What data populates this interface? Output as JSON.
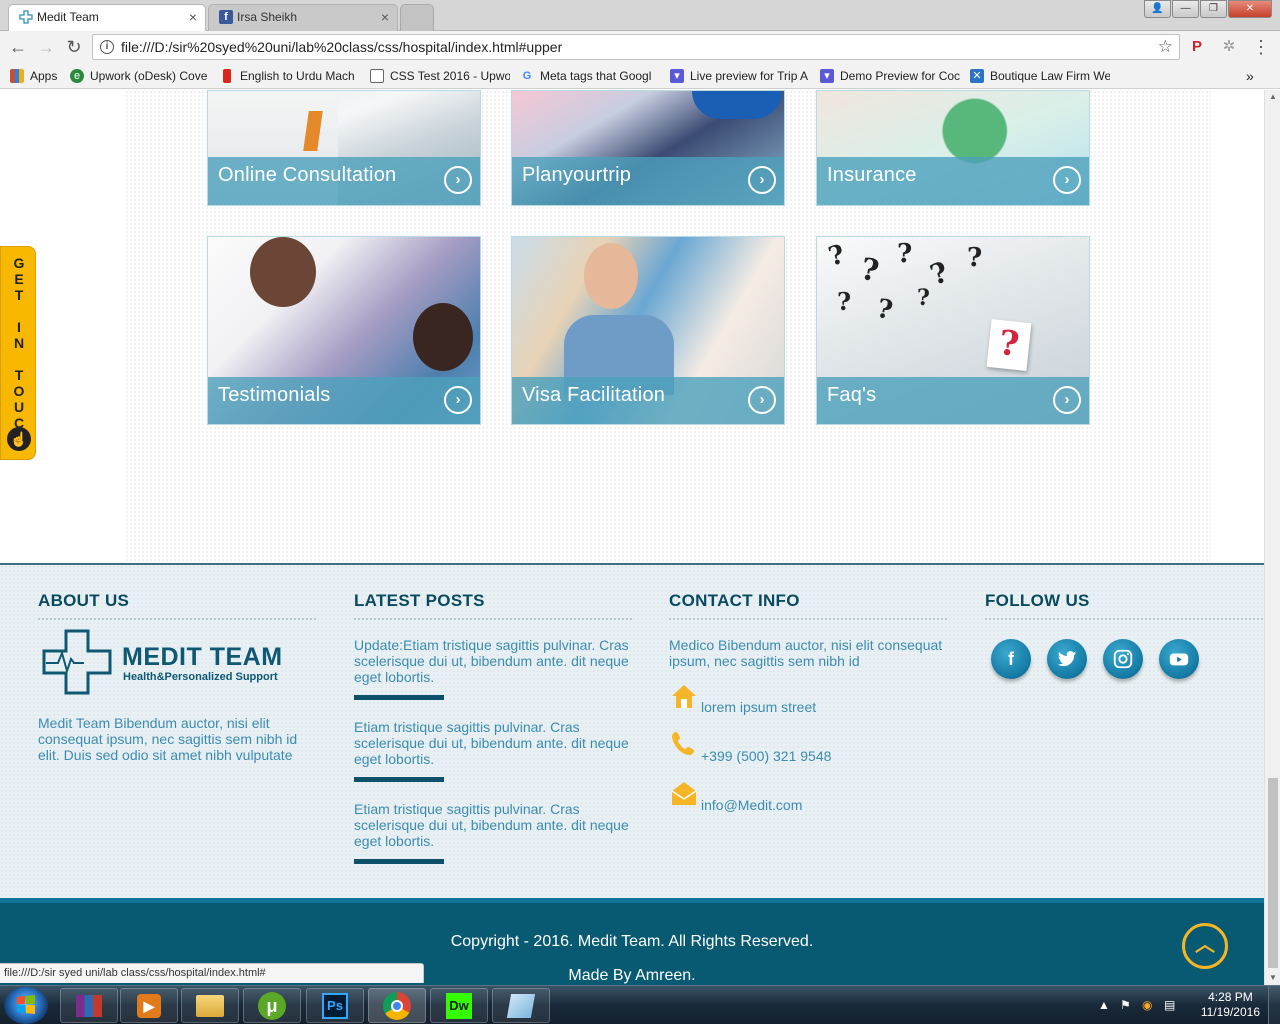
{
  "browser": {
    "tabs": [
      {
        "title": "Medit Team",
        "active": true
      },
      {
        "title": "Irsa Sheikh",
        "active": false
      }
    ],
    "address": "file:///D:/sir%20syed%20uni/lab%20class/css/hospital/index.html#upper",
    "bookmarks": [
      {
        "label": "Apps",
        "icon": "apps-grid-icon",
        "color": "#d04a2c"
      },
      {
        "label": "Upwork (oDesk) Cove",
        "icon": "upwork-icon",
        "color": "#2a8a3a"
      },
      {
        "label": "English to Urdu Mach",
        "icon": "translate-icon",
        "color": "#d9251c"
      },
      {
        "label": "CSS Test 2016 - Upwo",
        "icon": "page-icon",
        "color": "#666666"
      },
      {
        "label": "Meta tags that Googl",
        "icon": "google-icon",
        "color": "#4285f4"
      },
      {
        "label": "Live preview for Trip A",
        "icon": "themeforest-icon",
        "color": "#5a5ad6"
      },
      {
        "label": "Demo Preview for Coc",
        "icon": "themeforest-icon",
        "color": "#5a5ad6"
      },
      {
        "label": "Boutique Law Firm We",
        "icon": "x-logo-icon",
        "color": "#2b73c8"
      }
    ]
  },
  "services": [
    {
      "title": "Online Consultation",
      "arrow": "›"
    },
    {
      "title": "Planyourtrip",
      "arrow": "›"
    },
    {
      "title": "Insurance",
      "arrow": "›"
    },
    {
      "title": "Testimonials",
      "arrow": "›"
    },
    {
      "title": "Visa Facilitation",
      "arrow": "›"
    },
    {
      "title": "Faq's",
      "arrow": "›"
    }
  ],
  "get_in_touch": "G\nE\nT\n \nI\nN\n \nT\nO\nU\nC\nH",
  "footer": {
    "about": {
      "heading": "ABOUT US",
      "logo_name": "MEDIT TEAM",
      "logo_tagline": "Health&Personalized Support",
      "text": "Medit Team Bibendum auctor, nisi elit consequat ipsum, nec sagittis sem nibh id elit. Duis sed odio sit amet nibh vulputate"
    },
    "posts": {
      "heading": "LATEST POSTS",
      "items": [
        "Update:Etiam tristique sagittis pulvinar. Cras scelerisque dui ut, bibendum ante. dit neque eget lobortis.",
        "Etiam tristique sagittis pulvinar. Cras scelerisque dui ut, bibendum ante. dit neque eget lobortis.",
        "Etiam tristique sagittis pulvinar. Cras scelerisque dui ut, bibendum ante. dit neque eget lobortis."
      ]
    },
    "contact": {
      "heading": "CONTACT INFO",
      "intro": "Medico Bibendum auctor, nisi elit consequat ipsum, nec sagittis sem nibh id",
      "address": "lorem ipsum street",
      "phone": "+399 (500) 321 9548",
      "email": "info@Medit.com"
    },
    "follow": {
      "heading": "FOLLOW US",
      "networks": [
        "facebook",
        "twitter",
        "instagram",
        "youtube"
      ]
    },
    "copyright": "Copyright - 2016. Medit Team. All Rights Reserved.",
    "made_by": "Made By Amreen."
  },
  "status_url": "file:///D:/sir syed uni/lab class/css/hospital/index.html#",
  "taskbar": {
    "time": "4:28 PM",
    "date": "11/19/2016",
    "apps": [
      "winrar",
      "media-player",
      "file-explorer",
      "utorrent",
      "photoshop",
      "chrome",
      "dreamweaver",
      "notepad"
    ]
  },
  "colors": {
    "heading": "#0a4a60",
    "body_text": "#3c8cb0",
    "footer_bar": "#075a72",
    "accent": "#f5b526"
  }
}
